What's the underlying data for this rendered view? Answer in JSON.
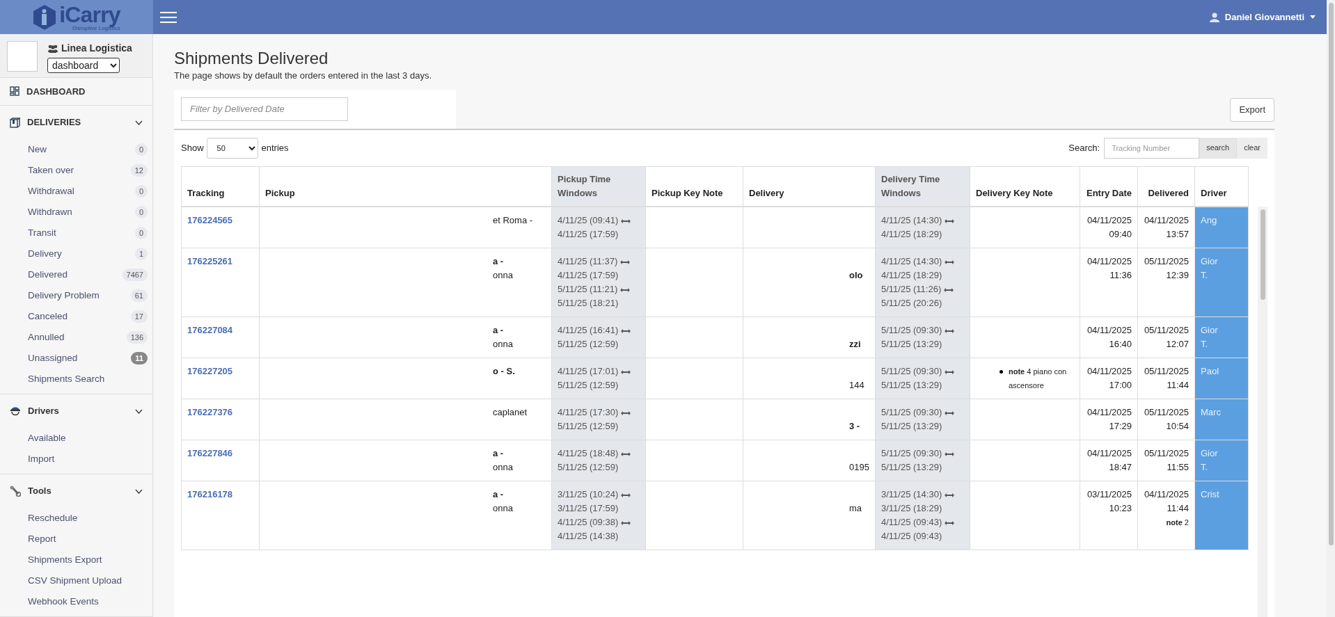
{
  "topbar": {
    "logo_text": "iCarry",
    "logo_tagline": "Disruptive Logistics",
    "user": "Daniel Giovannetti"
  },
  "sidebar": {
    "company": "Linea Logistica",
    "view_select": "dashboard",
    "dashboard": "DASHBOARD",
    "sections": [
      {
        "title": "DELIVERIES",
        "expanded": true,
        "items": [
          {
            "label": "New",
            "count": "0",
            "highlighted": false
          },
          {
            "label": "Taken over",
            "count": "12",
            "highlighted": false
          },
          {
            "label": "Withdrawal",
            "count": "0",
            "highlighted": false
          },
          {
            "label": "Withdrawn",
            "count": "0",
            "highlighted": false
          },
          {
            "label": "Transit",
            "count": "0",
            "highlighted": false
          },
          {
            "label": "Delivery",
            "count": "1",
            "highlighted": false
          },
          {
            "label": "Delivered",
            "count": "7467",
            "highlighted": false
          },
          {
            "label": "Delivery Problem",
            "count": "61",
            "highlighted": false
          },
          {
            "label": "Canceled",
            "count": "17",
            "highlighted": false
          },
          {
            "label": "Annulled",
            "count": "136",
            "highlighted": false
          },
          {
            "label": "Unassigned",
            "count": "11",
            "highlighted": true
          },
          {
            "label": "Shipments Search"
          }
        ]
      },
      {
        "title": "Drivers",
        "expanded": true,
        "items": [
          {
            "label": "Available"
          },
          {
            "label": "Import"
          }
        ]
      },
      {
        "title": "Tools",
        "expanded": true,
        "items": [
          {
            "label": "Reschedule"
          },
          {
            "label": "Report"
          },
          {
            "label": "Shipments Export"
          },
          {
            "label": "CSV Shipment Upload"
          },
          {
            "label": "Webhook Events"
          }
        ]
      }
    ]
  },
  "page": {
    "title": "Shipments Delivered",
    "subtitle": "The page shows by default the orders entered in the last 3 days.",
    "date_filter_placeholder": "Filter by Delivered Date",
    "export": "Export",
    "show_label": "Show",
    "entries_value": "50",
    "entries_label": "entries",
    "search_label": "Search:",
    "search_placeholder": "Tracking Number",
    "search_button": "search",
    "clear_button": "clear"
  },
  "table": {
    "columns": [
      {
        "label": "Tracking",
        "shaded": false
      },
      {
        "label": "Pickup",
        "shaded": false
      },
      {
        "label": "Pickup Time Windows",
        "shaded": true
      },
      {
        "label": "Pickup Key Note",
        "shaded": false
      },
      {
        "label": "Delivery",
        "shaded": false
      },
      {
        "label": "Delivery Time Windows",
        "shaded": true
      },
      {
        "label": "Delivery Key Note",
        "shaded": false
      },
      {
        "label": "Entry Date",
        "shaded": false
      },
      {
        "label": "Delivered",
        "shaded": false
      },
      {
        "label": "Driver",
        "shaded": false
      }
    ],
    "rows": [
      {
        "tracking": "176224565",
        "pickup": [
          {
            "text": "et Roma -",
            "bold": false
          }
        ],
        "pickup_windows": [
          {
            "from": "4/11/25 (09:41)",
            "to": "4/11/25 (17:59)"
          }
        ],
        "delivery_windows": [
          {
            "from": "4/11/25 (14:30)",
            "to": "4/11/25 (18:29)"
          }
        ],
        "entry_date": [
          "04/11/2025",
          "09:40"
        ],
        "delivered": [
          "04/11/2025",
          "13:57"
        ],
        "driver": [
          "Ang"
        ]
      },
      {
        "tracking": "176225261",
        "pickup": [
          {
            "text": "a -",
            "bold": true
          },
          {
            "text": "onna",
            "bold": false
          }
        ],
        "pickup_windows": [
          {
            "from": "4/11/25 (11:37)",
            "to": "4/11/25 (17:59)"
          },
          {
            "from": "5/11/25 (11:21)",
            "to": "5/11/25 (18:21)"
          }
        ],
        "delivery": [
          {
            "text": "olo",
            "bold": true
          }
        ],
        "delivery_windows": [
          {
            "from": "4/11/25 (14:30)",
            "to": "4/11/25 (18:29)"
          },
          {
            "from": "5/11/25 (11:26)",
            "to": "5/11/25 (20:26)"
          }
        ],
        "entry_date": [
          "04/11/2025",
          "11:36"
        ],
        "delivered": [
          "05/11/2025",
          "12:39"
        ],
        "driver": [
          "Gior",
          "T."
        ]
      },
      {
        "tracking": "176227084",
        "pickup": [
          {
            "text": "a -",
            "bold": true
          },
          {
            "text": "onna",
            "bold": false
          }
        ],
        "pickup_windows": [
          {
            "from": "4/11/25 (16:41)",
            "to": "5/11/25 (12:59)"
          }
        ],
        "delivery": [
          {
            "text": "zzi",
            "bold": true
          }
        ],
        "delivery_windows": [
          {
            "from": "5/11/25 (09:30)",
            "to": "5/11/25 (13:29)"
          }
        ],
        "entry_date": [
          "04/11/2025",
          "16:40"
        ],
        "delivered": [
          "05/11/2025",
          "12:07"
        ],
        "driver": [
          "Gior",
          "T."
        ]
      },
      {
        "tracking": "176227205",
        "pickup": [
          {
            "text": "o - S.",
            "bold": true
          }
        ],
        "pickup_windows": [
          {
            "from": "4/11/25 (17:01)",
            "to": "5/11/25 (12:59)"
          }
        ],
        "delivery": [
          {
            "text": "144",
            "bold": false
          }
        ],
        "delivery_windows": [
          {
            "from": "5/11/25 (09:30)",
            "to": "5/11/25 (13:29)"
          }
        ],
        "delivery_notes": [
          "**note** 4 piano con ascensore"
        ],
        "entry_date": [
          "04/11/2025",
          "17:00"
        ],
        "delivered": [
          "05/11/2025",
          "11:44"
        ],
        "driver": [
          "Paol"
        ]
      },
      {
        "tracking": "176227376",
        "pickup": [
          {
            "text": "caplanet",
            "bold": false
          }
        ],
        "pickup_windows": [
          {
            "from": "4/11/25 (17:30)",
            "to": "5/11/25 (12:59)"
          }
        ],
        "delivery": [
          {
            "text": "3 -",
            "bold": true
          }
        ],
        "delivery_windows": [
          {
            "from": "5/11/25 (09:30)",
            "to": "5/11/25 (13:29)"
          }
        ],
        "entry_date": [
          "04/11/2025",
          "17:29"
        ],
        "delivered": [
          "05/11/2025",
          "10:54"
        ],
        "driver": [
          "Marc"
        ]
      },
      {
        "tracking": "176227846",
        "pickup": [
          {
            "text": "a -",
            "bold": true
          },
          {
            "text": "onna",
            "bold": false
          }
        ],
        "pickup_windows": [
          {
            "from": "4/11/25 (18:48)",
            "to": "5/11/25 (12:59)"
          }
        ],
        "delivery": [
          {
            "text": "0195",
            "bold": false
          }
        ],
        "delivery_windows": [
          {
            "from": "5/11/25 (09:30)",
            "to": "5/11/25 (13:29)"
          }
        ],
        "entry_date": [
          "04/11/2025",
          "18:47"
        ],
        "delivered": [
          "05/11/2025",
          "11:55"
        ],
        "driver": [
          "Gior",
          "T."
        ]
      },
      {
        "tracking": "176216178",
        "pickup": [
          {
            "text": "a -",
            "bold": true
          },
          {
            "text": "onna",
            "bold": false
          }
        ],
        "pickup_windows": [
          {
            "from": "3/11/25 (10:24)",
            "to": "3/11/25 (17:59)"
          },
          {
            "from": "4/11/25 (09:38)",
            "to": "4/11/25 (14:38)"
          }
        ],
        "delivery": [
          {
            "text": "ma",
            "bold": false
          }
        ],
        "delivery_windows": [
          {
            "from": "3/11/25 (14:30)",
            "to": "3/11/25 (18:29)"
          },
          {
            "from": "4/11/25 (09:43)",
            "to": "4/11/25 (09:43)"
          }
        ],
        "entry_date": [
          "03/11/2025",
          "10:23"
        ],
        "delivered": [
          "04/11/2025",
          "11:44"
        ],
        "delivered_note": "**note** 2",
        "driver": [
          "Crist"
        ]
      }
    ]
  }
}
